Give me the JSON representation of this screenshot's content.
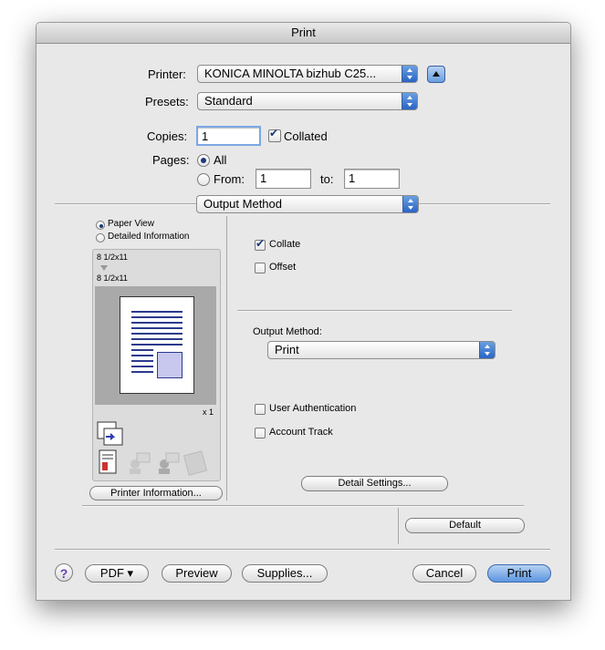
{
  "window": {
    "title": "Print"
  },
  "printer": {
    "label": "Printer:",
    "value": "KONICA MINOLTA bizhub C25..."
  },
  "presets": {
    "label": "Presets:",
    "value": "Standard"
  },
  "copies": {
    "label": "Copies:",
    "value": "1",
    "collated_label": "Collated",
    "collated": true
  },
  "pages": {
    "label": "Pages:",
    "all_label": "All",
    "from_label": "From:",
    "from_value": "1",
    "to_label": "to:",
    "to_value": "1",
    "selected": "All"
  },
  "section_popup": {
    "value": "Output Method"
  },
  "preview": {
    "paper_view_label": "Paper View",
    "detailed_info_label": "Detailed Information",
    "selected": "Paper View",
    "size_top": "8 1/2x11",
    "size_bottom": "8 1/2x11",
    "copies_count": "x 1",
    "printer_info_button": "Printer Information..."
  },
  "options": {
    "collate_label": "Collate",
    "collate": true,
    "offset_label": "Offset",
    "offset": false,
    "output_method_label": "Output Method:",
    "output_method_value": "Print",
    "user_auth_label": "User Authentication",
    "user_auth": false,
    "account_track_label": "Account Track",
    "account_track": false,
    "detail_settings_button": "Detail Settings...",
    "default_button": "Default"
  },
  "bottom": {
    "help": "?",
    "pdf_button": "PDF ▾",
    "preview_button": "Preview",
    "supplies_button": "Supplies...",
    "cancel_button": "Cancel",
    "print_button": "Print"
  },
  "colors": {
    "accent": "#2a64c6",
    "window_bg": "#e8e8e8",
    "preview_blue": "#2b3a8c"
  }
}
